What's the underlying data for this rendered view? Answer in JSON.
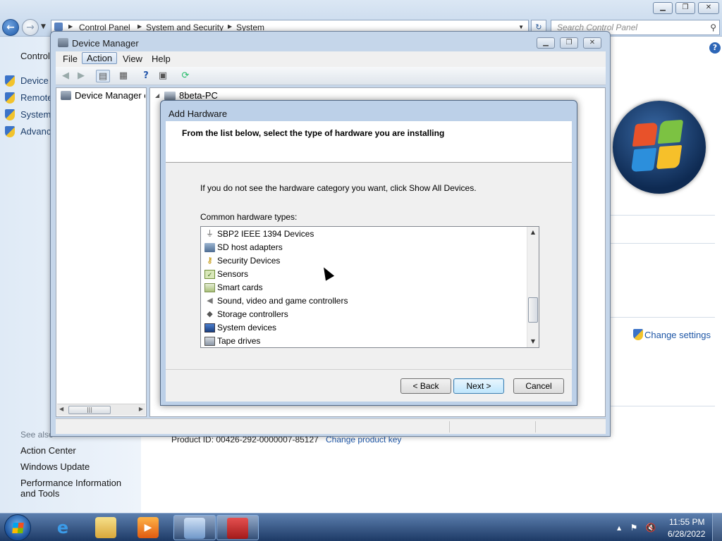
{
  "control_panel": {
    "breadcrumbs": [
      "Control Panel",
      "System and Security",
      "System"
    ],
    "search_placeholder": "Search Control Panel",
    "sidebar_header": "Control",
    "sidebar_links": [
      "Device M",
      "Remote",
      "System",
      "Advanc"
    ],
    "see_also_label": "See also",
    "see_also_links": [
      "Action Center",
      "Windows Update",
      "Performance Information and Tools"
    ],
    "change_settings": "Change settings",
    "product_id": "Product ID: 00426-292-0000007-85127",
    "change_product_key": "Change product key"
  },
  "device_manager": {
    "title": "Device Manager",
    "menus": [
      "File",
      "Action",
      "View",
      "Help"
    ],
    "active_menu": "Action",
    "tree_left_item": "Device Manager on",
    "computer_name": "8beta-PC"
  },
  "add_hardware": {
    "title": "Add Hardware",
    "heading": "From the list below, select the type of hardware you are installing",
    "info": "If you do not see the hardware category you want, click Show All Devices.",
    "list_label": "Common hardware types:",
    "items": [
      {
        "label": "SBP2 IEEE 1394 Devices",
        "icon": "firewire-plug-icon"
      },
      {
        "label": "SD host adapters",
        "icon": "sd-card-icon"
      },
      {
        "label": "Security Devices",
        "icon": "key-icon"
      },
      {
        "label": "Sensors",
        "icon": "sensor-icon"
      },
      {
        "label": "Smart cards",
        "icon": "smart-card-icon"
      },
      {
        "label": "Sound, video and game controllers",
        "icon": "speaker-icon"
      },
      {
        "label": "Storage controllers",
        "icon": "storage-controller-icon"
      },
      {
        "label": "System devices",
        "icon": "system-device-icon"
      },
      {
        "label": "Tape drives",
        "icon": "tape-drive-icon"
      }
    ],
    "buttons": {
      "back": "< Back",
      "next": "Next >",
      "cancel": "Cancel"
    }
  },
  "taskbar": {
    "apps": [
      "internet-explorer-icon",
      "windows-explorer-icon",
      "media-player-icon",
      "control-panel-icon",
      "device-manager-toolbox-icon"
    ],
    "time": "11:55 PM",
    "date": "6/28/2022"
  },
  "colors": {
    "link": "#1e56a6",
    "sidebar_text": "#1e3f6b",
    "window_frame": "#c5d6ea",
    "taskbar_top": "#5c7fae",
    "taskbar_bottom": "#1d3a66"
  }
}
